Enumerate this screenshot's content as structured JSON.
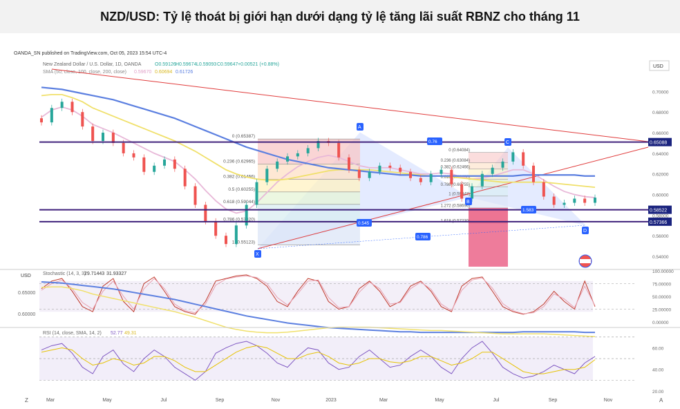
{
  "page": {
    "title": "NZD/USD: Tỷ lệ thoát bị giới hạn dưới dạng tỷ lệ tăng lãi suất RBNZ cho tháng 11"
  },
  "chart_meta": {
    "published": "OANDA_SN published on TradingView.com, Oct 05, 2023 15:54 UTC-4",
    "symbol_line": "New Zealand Dollar / U.S. Dollar, 1D, OANDA",
    "ohlc": {
      "o": "O0.59126",
      "h": "H0.59674",
      "l": "L0.59093",
      "c": "C0.59647",
      "chg": "+0.00521 (+0.88%)"
    },
    "sma_line": "SMA (50, close, 100, close, 200, close)",
    "sma_vals": [
      "0.59670",
      "0.60694",
      "0.61726"
    ],
    "currency": "USD",
    "stoch_line": "Stochastic (14, 3, 3)",
    "stoch_vals": [
      "29.71443",
      "31.93327"
    ],
    "rsi_line": "RSI (14, close, SMA, 14, 2)",
    "rsi_vals": [
      "52.77",
      "49.31"
    ]
  },
  "chart_data": [
    {
      "type": "line",
      "name": "price",
      "x": [
        "Mar",
        "May",
        "Jul",
        "Sep",
        "Nov",
        "2023",
        "Mar",
        "May",
        "Jul",
        "Sep",
        "Nov"
      ],
      "y_ticks": [
        "0.70000",
        "0.68000",
        "0.66000",
        "0.64000",
        "0.62000",
        "0.60000",
        "0.58000",
        "0.56000",
        "0.54000"
      ],
      "ylim": [
        0.53,
        0.715
      ],
      "series": [
        {
          "name": "price",
          "values": [
            0.67,
            0.684,
            0.69,
            0.68,
            0.666,
            0.652,
            0.66,
            0.65,
            0.64,
            0.636,
            0.622,
            0.628,
            0.634,
            0.625,
            0.608,
            0.59,
            0.574,
            0.56,
            0.552,
            0.57,
            0.59,
            0.612,
            0.625,
            0.632,
            0.637,
            0.64,
            0.645,
            0.652,
            0.65,
            0.636,
            0.624,
            0.616,
            0.622,
            0.628,
            0.626,
            0.622,
            0.616,
            0.612,
            0.62,
            0.624,
            0.61,
            0.596,
            0.608,
            0.62,
            0.626,
            0.632,
            0.641,
            0.628,
            0.612,
            0.598,
            0.59,
            0.592,
            0.596,
            0.592,
            0.597
          ]
        },
        {
          "values": [
            0.675,
            0.682,
            0.685,
            0.682,
            0.676,
            0.668,
            0.664,
            0.66,
            0.655,
            0.65,
            0.645,
            0.64,
            0.636,
            0.632,
            0.624,
            0.615,
            0.604,
            0.594,
            0.586,
            0.582,
            0.584,
            0.592,
            0.602,
            0.612,
            0.62,
            0.627,
            0.632,
            0.636,
            0.638,
            0.636,
            0.632,
            0.628,
            0.626,
            0.626,
            0.626,
            0.624,
            0.622,
            0.62,
            0.62,
            0.621,
            0.62,
            0.617,
            0.615,
            0.616,
            0.618,
            0.621,
            0.624,
            0.624,
            0.62,
            0.614,
            0.608,
            0.603,
            0.6,
            0.598,
            0.597
          ]
        },
        {
          "values": [
            0.696,
            0.697,
            0.697,
            0.694,
            0.69,
            0.684,
            0.68,
            0.676,
            0.672,
            0.668,
            0.664,
            0.66,
            0.656,
            0.652,
            0.647,
            0.642,
            0.636,
            0.63,
            0.624,
            0.62,
            0.617,
            0.615,
            0.614,
            0.614,
            0.615,
            0.617,
            0.619,
            0.621,
            0.623,
            0.624,
            0.624,
            0.624,
            0.624,
            0.623,
            0.622,
            0.621,
            0.62,
            0.619,
            0.618,
            0.618,
            0.617,
            0.616,
            0.615,
            0.614,
            0.613,
            0.612,
            0.612,
            0.612,
            0.612,
            0.612,
            0.611,
            0.61,
            0.609,
            0.608,
            0.607
          ]
        },
        {
          "values": [
            0.704,
            0.703,
            0.702,
            0.7,
            0.698,
            0.696,
            0.694,
            0.692,
            0.689,
            0.686,
            0.683,
            0.68,
            0.677,
            0.674,
            0.67,
            0.666,
            0.662,
            0.658,
            0.654,
            0.65,
            0.646,
            0.643,
            0.64,
            0.637,
            0.634,
            0.632,
            0.63,
            0.628,
            0.626,
            0.625,
            0.624,
            0.623,
            0.622,
            0.621,
            0.62,
            0.619,
            0.619,
            0.618,
            0.618,
            0.618,
            0.618,
            0.618,
            0.618,
            0.618,
            0.618,
            0.618,
            0.618,
            0.619,
            0.619,
            0.619,
            0.619,
            0.619,
            0.619,
            0.618,
            0.618
          ]
        }
      ]
    },
    {
      "type": "line",
      "name": "stochastic",
      "y_ticks": [
        "100.00000",
        "75.00000",
        "50.00000",
        "25.00000",
        "0.00000"
      ],
      "ylim": [
        0,
        100
      ],
      "series": [
        {
          "values": [
            65,
            80,
            85,
            60,
            30,
            20,
            70,
            85,
            40,
            20,
            75,
            88,
            60,
            30,
            20,
            15,
            40,
            80,
            85,
            90,
            92,
            85,
            70,
            40,
            30,
            60,
            85,
            80,
            40,
            25,
            30,
            65,
            80,
            60,
            30,
            40,
            70,
            80,
            60,
            30,
            20,
            70,
            85,
            88,
            60,
            30,
            20,
            15,
            20,
            35,
            60,
            40,
            25,
            80,
            30
          ]
        },
        {
          "values": [
            62,
            75,
            82,
            65,
            38,
            25,
            60,
            80,
            50,
            25,
            65,
            85,
            65,
            35,
            22,
            18,
            35,
            72,
            84,
            88,
            90,
            87,
            75,
            48,
            33,
            55,
            80,
            82,
            48,
            28,
            30,
            58,
            78,
            65,
            35,
            38,
            65,
            78,
            64,
            35,
            22,
            62,
            82,
            86,
            66,
            36,
            22,
            16,
            18,
            30,
            55,
            45,
            28,
            70,
            32
          ]
        }
      ]
    },
    {
      "type": "line",
      "name": "rsi",
      "y_ticks": [
        "60.00",
        "40.00",
        "20.00"
      ],
      "ylim": [
        20,
        75
      ],
      "series": [
        {
          "values": [
            58,
            62,
            64,
            55,
            42,
            36,
            52,
            58,
            45,
            38,
            50,
            58,
            52,
            42,
            36,
            30,
            38,
            55,
            60,
            64,
            66,
            62,
            55,
            46,
            42,
            52,
            60,
            58,
            46,
            40,
            42,
            52,
            58,
            50,
            42,
            44,
            52,
            58,
            52,
            42,
            36,
            50,
            60,
            66,
            55,
            42,
            36,
            32,
            34,
            38,
            44,
            40,
            36,
            46,
            52
          ]
        },
        {
          "values": [
            56,
            58,
            60,
            58,
            50,
            44,
            46,
            50,
            48,
            44,
            46,
            52,
            52,
            48,
            42,
            38,
            38,
            44,
            50,
            56,
            60,
            62,
            60,
            55,
            50,
            50,
            54,
            56,
            52,
            46,
            44,
            46,
            50,
            50,
            47,
            46,
            48,
            52,
            52,
            48,
            44,
            46,
            50,
            56,
            56,
            50,
            44,
            38,
            36,
            36,
            38,
            40,
            40,
            42,
            49
          ]
        }
      ]
    }
  ],
  "annotations": {
    "levels": [
      {
        "label": "0.65088",
        "value": 0.65088,
        "color": "#3d1f7a"
      },
      {
        "label": "0.58522",
        "value": 0.58522,
        "color": "#3d1f7a"
      },
      {
        "label": "0.57366",
        "value": 0.57366,
        "color": "#3d1f7a"
      }
    ],
    "fib": [
      {
        "label": "0 (0.65387)",
        "value": 0.65387
      },
      {
        "label": "0.236 (0.62965)",
        "value": 0.62965
      },
      {
        "label": "0.382 (0.61466)",
        "value": 0.61466
      },
      {
        "label": "0.5 (0.60255)",
        "value": 0.60255
      },
      {
        "label": "0.618 (0.59044)",
        "value": 0.59044
      },
      {
        "label": "0.786 (0.57320)",
        "value": 0.5732
      },
      {
        "label": "1 (0.55123)",
        "value": 0.55123
      }
    ],
    "fib2": [
      {
        "label": "0 (0.64084)",
        "value": 0.64084
      },
      {
        "label": "0.236 (0.63084)",
        "value": 0.63084
      },
      {
        "label": "0.382 (0.62466)",
        "value": 0.62466
      },
      {
        "label": "0.618 (0.61466)",
        "value": 0.61466
      },
      {
        "label": "0.786 (0.60755)",
        "value": 0.60755
      },
      {
        "label": "1 (0.59848)",
        "value": 0.59848
      },
      {
        "label": "1.272 (0.58696)",
        "value": 0.58696
      },
      {
        "label": "1.618 (0.57230)",
        "value": 0.5723
      }
    ],
    "points": [
      "X",
      "A",
      "B",
      "C",
      "D"
    ],
    "ratios": [
      "0.76",
      "0.545",
      "0.786",
      "1.583"
    ],
    "stoch_left": [
      "0.65000",
      "0.60000"
    ]
  },
  "colors": {
    "price_up": "#26a69a",
    "price_dn": "#ef5350",
    "sma50": "#e8b8d8",
    "sma100": "#f0e06a",
    "sma200": "#5b7fe0",
    "trend": "#e03a3a",
    "level": "#3d1f7a",
    "badge": "#2962ff"
  },
  "x_axis": [
    "Mar",
    "May",
    "Jul",
    "Sep",
    "Nov",
    "2023",
    "Mar",
    "May",
    "Jul",
    "Sep",
    "Nov"
  ]
}
